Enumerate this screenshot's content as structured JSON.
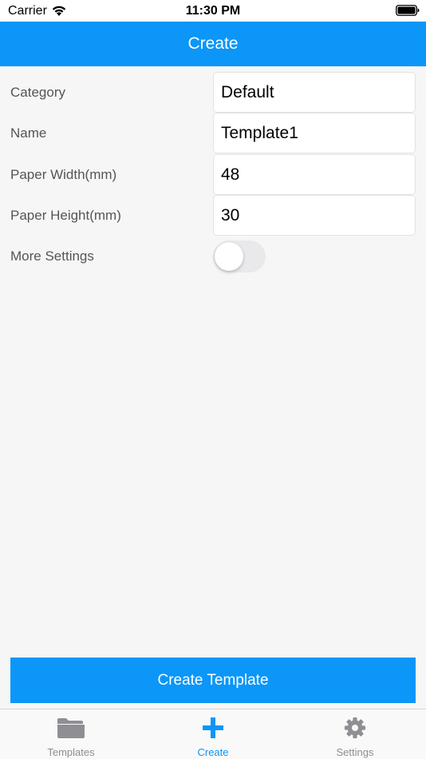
{
  "status_bar": {
    "carrier": "Carrier",
    "time": "11:30 PM",
    "wifi_icon": "wifi-icon",
    "battery_icon": "battery-icon"
  },
  "nav": {
    "title": "Create"
  },
  "form": {
    "category": {
      "label": "Category",
      "value": "Default"
    },
    "name": {
      "label": "Name",
      "value": "Template1"
    },
    "paper_width": {
      "label": "Paper Width(mm)",
      "value": "48"
    },
    "paper_height": {
      "label": "Paper Height(mm)",
      "value": "30"
    },
    "more_settings": {
      "label": "More Settings",
      "enabled": false
    }
  },
  "create_button": {
    "label": "Create Template"
  },
  "tab_bar": {
    "tabs": [
      {
        "label": "Templates",
        "icon": "folder-icon",
        "active": false
      },
      {
        "label": "Create",
        "icon": "plus-icon",
        "active": true
      },
      {
        "label": "Settings",
        "icon": "gear-icon",
        "active": false
      }
    ]
  },
  "colors": {
    "accent": "#0b96f8",
    "background": "#f6f6f6",
    "label": "#555555",
    "inactive_tab": "#8e8e93"
  }
}
